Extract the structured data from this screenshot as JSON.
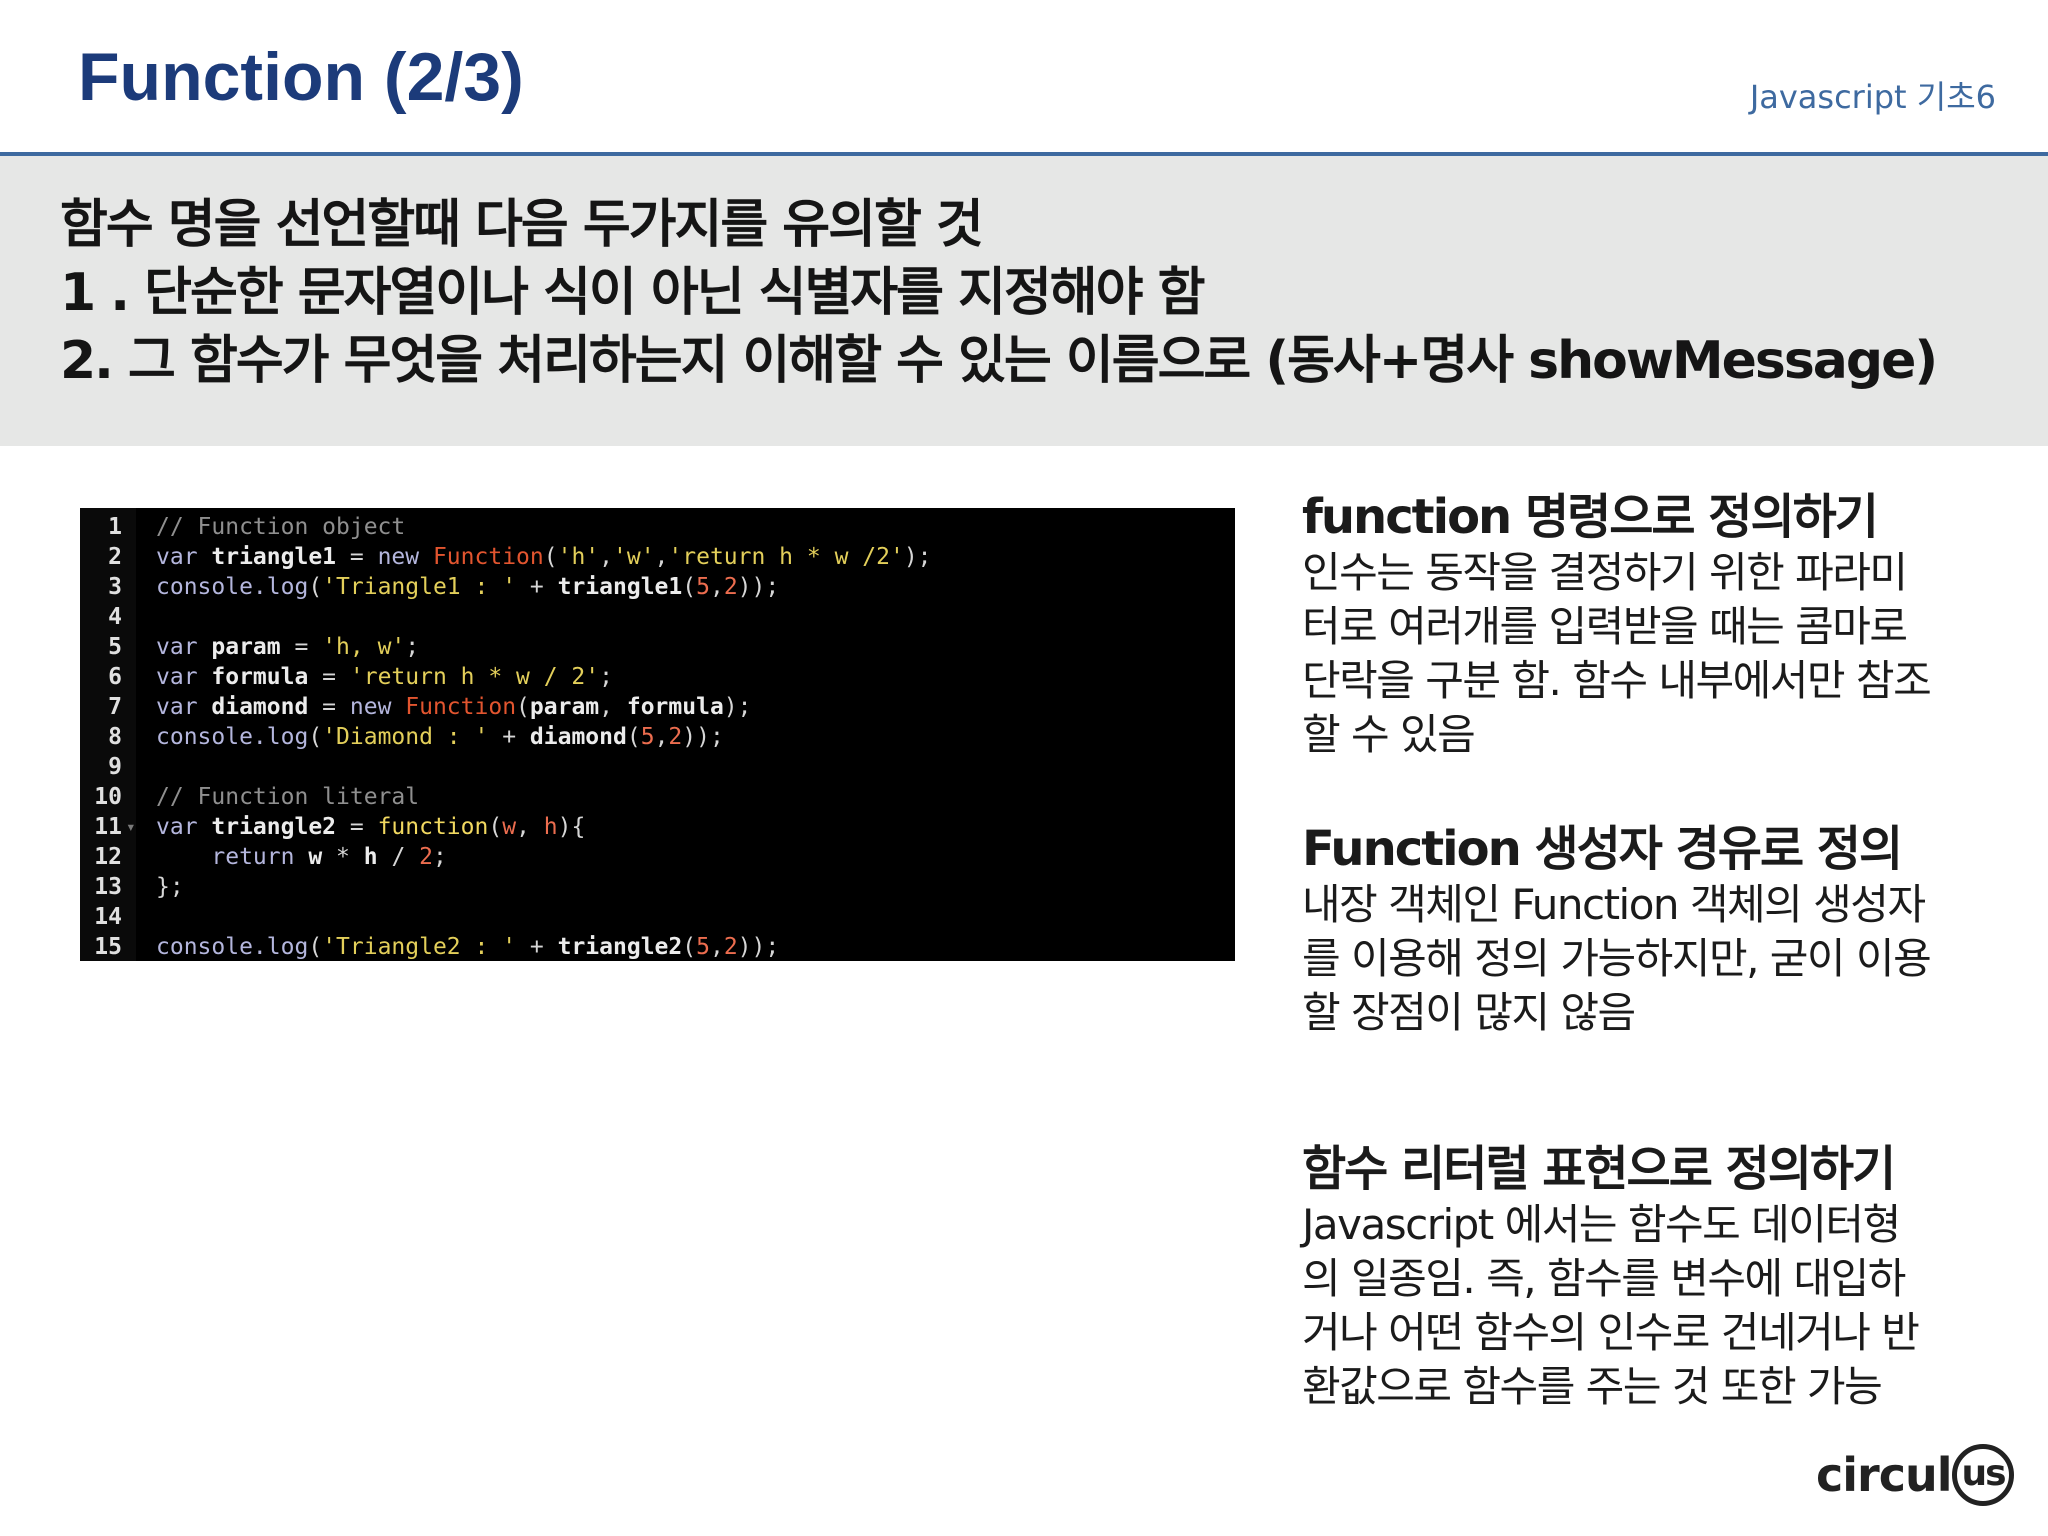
{
  "header": {
    "title": "Function (2/3)",
    "subtitle": "Javascript 기초6"
  },
  "intro": {
    "lines": [
      "함수 명을 선언할때 다음 두가지를 유의할 것",
      "1 . 단순한 문자열이나 식이 아닌 식별자를 지정해야 함",
      "2. 그 함수가 무엇을 처리하는지 이해할 수 있는 이름으로 (동사+명사 showMessage)"
    ]
  },
  "code": {
    "line_numbers": [
      "1",
      "2",
      "3",
      "4",
      "5",
      "6",
      "7",
      "8",
      "9",
      "10",
      "11",
      "12",
      "13",
      "14",
      "15"
    ],
    "fold_marker": "▾",
    "lines": [
      [
        {
          "c": "t-comment",
          "t": "// Function object"
        }
      ],
      [
        {
          "c": "t-kw",
          "t": "var "
        },
        {
          "c": "t-id",
          "t": "triangle1"
        },
        {
          "c": "t-punc",
          "t": " = "
        },
        {
          "c": "t-kw",
          "t": "new "
        },
        {
          "c": "t-fn",
          "t": "Function"
        },
        {
          "c": "t-punc",
          "t": "("
        },
        {
          "c": "t-str",
          "t": "'h'"
        },
        {
          "c": "t-punc",
          "t": ","
        },
        {
          "c": "t-str",
          "t": "'w'"
        },
        {
          "c": "t-punc",
          "t": ","
        },
        {
          "c": "t-str",
          "t": "'return h * w /2'"
        },
        {
          "c": "t-punc",
          "t": ");"
        }
      ],
      [
        {
          "c": "t-method",
          "t": "console.log"
        },
        {
          "c": "t-punc",
          "t": "("
        },
        {
          "c": "t-str",
          "t": "'Triangle1 : '"
        },
        {
          "c": "t-punc",
          "t": " + "
        },
        {
          "c": "t-id",
          "t": "triangle1"
        },
        {
          "c": "t-punc",
          "t": "("
        },
        {
          "c": "t-num",
          "t": "5"
        },
        {
          "c": "t-punc",
          "t": ","
        },
        {
          "c": "t-num",
          "t": "2"
        },
        {
          "c": "t-punc",
          "t": "));"
        }
      ],
      [],
      [
        {
          "c": "t-kw",
          "t": "var "
        },
        {
          "c": "t-id",
          "t": "param"
        },
        {
          "c": "t-punc",
          "t": " = "
        },
        {
          "c": "t-str",
          "t": "'h, w'"
        },
        {
          "c": "t-punc",
          "t": ";"
        }
      ],
      [
        {
          "c": "t-kw",
          "t": "var "
        },
        {
          "c": "t-id",
          "t": "formula"
        },
        {
          "c": "t-punc",
          "t": " = "
        },
        {
          "c": "t-str",
          "t": "'return h * w / 2'"
        },
        {
          "c": "t-punc",
          "t": ";"
        }
      ],
      [
        {
          "c": "t-kw",
          "t": "var "
        },
        {
          "c": "t-id",
          "t": "diamond"
        },
        {
          "c": "t-punc",
          "t": " = "
        },
        {
          "c": "t-kw",
          "t": "new "
        },
        {
          "c": "t-fn",
          "t": "Function"
        },
        {
          "c": "t-punc",
          "t": "("
        },
        {
          "c": "t-id",
          "t": "param"
        },
        {
          "c": "t-punc",
          "t": ", "
        },
        {
          "c": "t-id",
          "t": "formula"
        },
        {
          "c": "t-punc",
          "t": ");"
        }
      ],
      [
        {
          "c": "t-method",
          "t": "console.log"
        },
        {
          "c": "t-punc",
          "t": "("
        },
        {
          "c": "t-str",
          "t": "'Diamond : '"
        },
        {
          "c": "t-punc",
          "t": " + "
        },
        {
          "c": "t-id",
          "t": "diamond"
        },
        {
          "c": "t-punc",
          "t": "("
        },
        {
          "c": "t-num",
          "t": "5"
        },
        {
          "c": "t-punc",
          "t": ","
        },
        {
          "c": "t-num",
          "t": "2"
        },
        {
          "c": "t-punc",
          "t": "));"
        }
      ],
      [],
      [
        {
          "c": "t-comment",
          "t": "// Function literal"
        }
      ],
      [
        {
          "c": "t-kw",
          "t": "var "
        },
        {
          "c": "t-id",
          "t": "triangle2"
        },
        {
          "c": "t-punc",
          "t": " = "
        },
        {
          "c": "t-fkw",
          "t": "function"
        },
        {
          "c": "t-punc",
          "t": "("
        },
        {
          "c": "t-num",
          "t": "w"
        },
        {
          "c": "t-punc",
          "t": ", "
        },
        {
          "c": "t-num",
          "t": "h"
        },
        {
          "c": "t-punc",
          "t": "){"
        }
      ],
      [
        {
          "c": "t-punc",
          "t": "    "
        },
        {
          "c": "t-kw",
          "t": "return "
        },
        {
          "c": "t-id",
          "t": "w"
        },
        {
          "c": "t-punc",
          "t": " * "
        },
        {
          "c": "t-id",
          "t": "h"
        },
        {
          "c": "t-punc",
          "t": " / "
        },
        {
          "c": "t-num",
          "t": "2"
        },
        {
          "c": "t-punc",
          "t": ";"
        }
      ],
      [
        {
          "c": "t-punc",
          "t": "};"
        }
      ],
      [],
      [
        {
          "c": "t-method",
          "t": "console.log"
        },
        {
          "c": "t-punc",
          "t": "("
        },
        {
          "c": "t-str",
          "t": "'Triangle2 : '"
        },
        {
          "c": "t-punc",
          "t": " + "
        },
        {
          "c": "t-id",
          "t": "triangle2"
        },
        {
          "c": "t-punc",
          "t": "("
        },
        {
          "c": "t-num",
          "t": "5"
        },
        {
          "c": "t-punc",
          "t": ","
        },
        {
          "c": "t-num",
          "t": "2"
        },
        {
          "c": "t-punc",
          "t": "));"
        }
      ]
    ]
  },
  "sections": [
    {
      "heading": "function 명령으로 정의하기",
      "body": [
        "인수는 동작을 결정하기 위한 파라미",
        "터로 여러개를 입력받을 때는 콤마로",
        "단락을 구분 함. 함수 내부에서만 참조",
        "할 수 있음"
      ]
    },
    {
      "heading": "Function 생성자 경유로 정의",
      "body": [
        "내장 객체인 Function 객체의 생성자",
        "를 이용해 정의 가능하지만, 굳이 이용",
        "할 장점이 많지 않음"
      ]
    },
    {
      "heading": "함수 리터럴 표현으로 정의하기",
      "body": [
        "Javascript 에서는 함수도 데이터형",
        "의 일종임. 즉, 함수를 변수에 대입하",
        "거나 어떤 함수의 인수로 건네거나 반",
        "환값으로 함수를 주는 것 또한 가능"
      ]
    }
  ],
  "logo": {
    "text": "circul",
    "ring_text": "us"
  }
}
